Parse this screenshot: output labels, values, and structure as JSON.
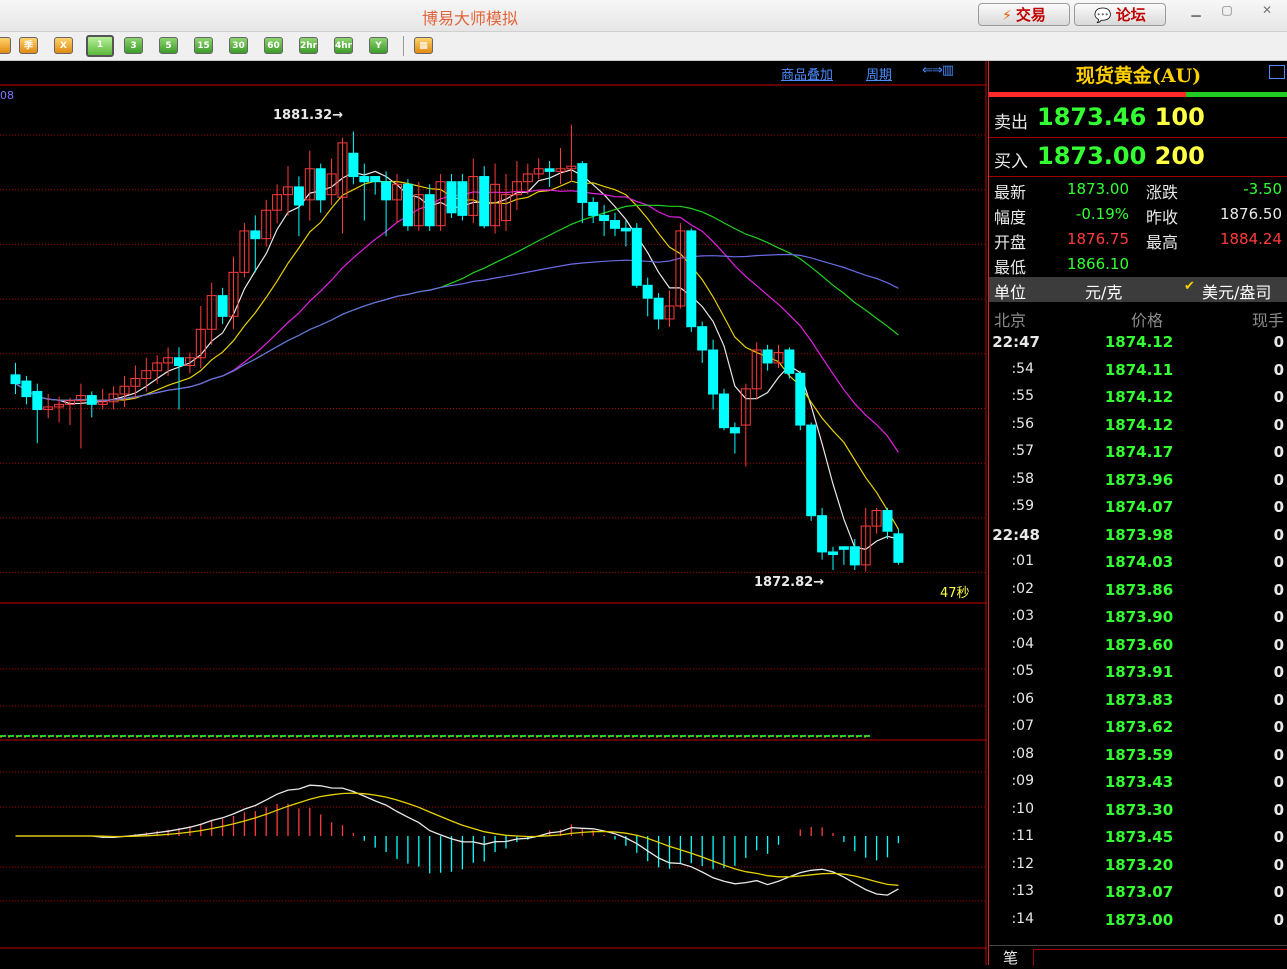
{
  "app": {
    "title": "博易大师模拟"
  },
  "titlebar": {
    "trade_label": "交易",
    "forum_label": "论坛"
  },
  "toolbar": {
    "buttons": [
      {
        "label": "季",
        "icon": "quarter-icon"
      },
      {
        "label": "X",
        "icon": "x-icon"
      },
      {
        "label": "1",
        "selected": true
      },
      {
        "label": "3"
      },
      {
        "label": "5"
      },
      {
        "label": "15"
      },
      {
        "label": "30"
      },
      {
        "label": "60"
      },
      {
        "label": "2hr"
      },
      {
        "label": "4hr"
      },
      {
        "label": "Y"
      }
    ]
  },
  "chart_links": {
    "overlay": "商品叠加",
    "period": "周期"
  },
  "chart_data": {
    "type": "candlestick",
    "high_label": "1881.32→",
    "low_label": "1872.82→",
    "countdown": "47秒",
    "indicator_label_fragment": "08",
    "candles": [
      [
        1876.62,
        1876.45,
        1876.85,
        1876.25
      ],
      [
        1876.5,
        1876.2,
        1876.6,
        1876.05
      ],
      [
        1876.3,
        1875.95,
        1876.45,
        1875.3
      ],
      [
        1875.95,
        1876.0,
        1876.25,
        1875.78
      ],
      [
        1876.0,
        1876.05,
        1876.2,
        1875.7
      ],
      [
        1876.05,
        1876.12,
        1876.18,
        1875.65
      ],
      [
        1876.12,
        1876.22,
        1876.45,
        1875.2
      ],
      [
        1876.22,
        1876.05,
        1876.3,
        1875.8
      ],
      [
        1876.05,
        1876.1,
        1876.35,
        1875.95
      ],
      [
        1876.1,
        1876.25,
        1876.4,
        1875.95
      ],
      [
        1876.25,
        1876.4,
        1876.6,
        1876.0
      ],
      [
        1876.4,
        1876.55,
        1876.8,
        1876.15
      ],
      [
        1876.55,
        1876.7,
        1876.95,
        1876.3
      ],
      [
        1876.7,
        1876.85,
        1877.0,
        1876.45
      ],
      [
        1876.85,
        1876.95,
        1877.15,
        1876.6
      ],
      [
        1876.95,
        1876.8,
        1877.15,
        1875.95
      ],
      [
        1876.8,
        1876.95,
        1877.05,
        1876.65
      ],
      [
        1876.95,
        1877.5,
        1877.95,
        1876.75
      ],
      [
        1877.5,
        1878.15,
        1878.4,
        1877.2
      ],
      [
        1878.15,
        1877.75,
        1878.3,
        1877.6
      ],
      [
        1877.75,
        1878.6,
        1878.9,
        1877.5
      ],
      [
        1878.6,
        1879.4,
        1879.55,
        1878.5
      ],
      [
        1879.4,
        1879.25,
        1879.7,
        1878.6
      ],
      [
        1879.25,
        1879.8,
        1880.0,
        1879.1
      ],
      [
        1879.8,
        1880.1,
        1880.3,
        1879.55
      ],
      [
        1880.1,
        1880.25,
        1880.65,
        1879.7
      ],
      [
        1880.25,
        1879.9,
        1880.45,
        1879.3
      ],
      [
        1880.0,
        1880.6,
        1880.95,
        1879.6
      ],
      [
        1880.6,
        1880.0,
        1880.7,
        1879.75
      ],
      [
        1880.1,
        1880.5,
        1880.8,
        1879.9
      ],
      [
        1880.05,
        1881.1,
        1881.2,
        1879.35
      ],
      [
        1880.9,
        1880.45,
        1881.32,
        1880.3
      ],
      [
        1880.45,
        1880.35,
        1880.7,
        1879.6
      ],
      [
        1880.45,
        1880.35,
        1880.45,
        1880.1
      ],
      [
        1880.35,
        1880.0,
        1880.55,
        1879.3
      ],
      [
        1880.0,
        1880.3,
        1880.5,
        1879.55
      ],
      [
        1880.3,
        1879.5,
        1880.4,
        1879.4
      ],
      [
        1879.5,
        1880.1,
        1880.35,
        1879.4
      ],
      [
        1880.1,
        1879.5,
        1880.3,
        1879.4
      ],
      [
        1879.5,
        1880.35,
        1880.5,
        1879.4
      ],
      [
        1880.35,
        1879.75,
        1880.5,
        1879.65
      ],
      [
        1880.35,
        1879.7,
        1880.5,
        1879.6
      ],
      [
        1879.7,
        1880.45,
        1880.8,
        1879.55
      ],
      [
        1880.45,
        1879.5,
        1880.65,
        1879.45
      ],
      [
        1879.5,
        1880.3,
        1880.7,
        1879.35
      ],
      [
        1879.6,
        1880.1,
        1880.5,
        1879.4
      ],
      [
        1880.1,
        1880.35,
        1880.75,
        1879.8
      ],
      [
        1880.35,
        1880.5,
        1880.7,
        1880.1
      ],
      [
        1880.5,
        1880.6,
        1880.8,
        1880.4
      ],
      [
        1880.6,
        1880.55,
        1880.75,
        1880.25
      ],
      [
        1880.55,
        1880.6,
        1881.0,
        1880.3
      ],
      [
        1880.6,
        1880.65,
        1881.45,
        1880.35
      ],
      [
        1880.7,
        1879.95,
        1880.75,
        1879.55
      ],
      [
        1879.95,
        1879.7,
        1880.05,
        1879.55
      ],
      [
        1879.7,
        1879.6,
        1879.9,
        1879.3
      ],
      [
        1879.6,
        1879.45,
        1879.75,
        1879.3
      ],
      [
        1879.45,
        1879.4,
        1879.6,
        1879.1
      ],
      [
        1879.45,
        1878.35,
        1879.55,
        1878.3
      ],
      [
        1878.35,
        1878.1,
        1878.5,
        1877.75
      ],
      [
        1878.1,
        1877.7,
        1878.2,
        1877.5
      ],
      [
        1877.7,
        1877.95,
        1878.25,
        1877.55
      ],
      [
        1877.95,
        1879.4,
        1879.55,
        1877.9
      ],
      [
        1879.4,
        1877.55,
        1879.45,
        1877.45
      ],
      [
        1877.55,
        1877.1,
        1877.65,
        1876.85
      ],
      [
        1877.1,
        1876.25,
        1877.3,
        1875.95
      ],
      [
        1876.25,
        1875.6,
        1876.35,
        1875.55
      ],
      [
        1875.6,
        1875.5,
        1875.7,
        1875.1
      ],
      [
        1875.65,
        1876.35,
        1876.45,
        1874.85
      ],
      [
        1876.35,
        1877.1,
        1877.25,
        1876.15
      ],
      [
        1877.1,
        1876.85,
        1877.2,
        1876.7
      ],
      [
        1876.85,
        1877.05,
        1877.2,
        1876.75
      ],
      [
        1877.1,
        1876.65,
        1877.15,
        1876.55
      ],
      [
        1876.65,
        1875.65,
        1876.7,
        1875.55
      ],
      [
        1875.65,
        1873.9,
        1875.7,
        1873.8
      ],
      [
        1873.9,
        1873.2,
        1874.05,
        1873.05
      ],
      [
        1873.2,
        1873.15,
        1873.3,
        1872.85
      ],
      [
        1873.3,
        1873.25,
        1873.3,
        1872.95
      ],
      [
        1873.3,
        1872.95,
        1873.45,
        1872.85
      ],
      [
        1872.95,
        1873.7,
        1874.05,
        1872.82
      ],
      [
        1873.7,
        1874.0,
        1874.05,
        1873.55
      ],
      [
        1874.0,
        1873.6,
        1874.05,
        1873.45
      ],
      [
        1873.55,
        1873.0,
        1873.65,
        1872.95
      ]
    ]
  },
  "quote": {
    "title": "现货黄金(AU)",
    "sell_label": "卖出",
    "sell_price": "1873.46",
    "sell_vol": "100",
    "buy_label": "买入",
    "buy_price": "1873.00",
    "buy_vol": "200",
    "stats": {
      "latest_label": "最新",
      "latest": "1873.00",
      "change_label": "涨跌",
      "change": "-3.50",
      "amp_label": "幅度",
      "amp": "-0.19%",
      "prev_label": "昨收",
      "prev": "1876.50",
      "open_label": "开盘",
      "open": "1876.75",
      "high_label": "最高",
      "high": "1884.24",
      "low_label": "最低",
      "low": "1866.10"
    },
    "unit_label": "单位",
    "unit_value": "元/克",
    "unit_option": "美元/盎司",
    "tick_head": {
      "time": "北京",
      "price": "价格",
      "volume": "现手"
    },
    "ticks": [
      {
        "time": "22:47",
        "price": "1874.12",
        "vol": "0"
      },
      {
        "time": ":54",
        "price": "1874.11",
        "vol": "0"
      },
      {
        "time": ":55",
        "price": "1874.12",
        "vol": "0"
      },
      {
        "time": ":56",
        "price": "1874.12",
        "vol": "0"
      },
      {
        "time": ":57",
        "price": "1874.17",
        "vol": "0"
      },
      {
        "time": ":58",
        "price": "1873.96",
        "vol": "0"
      },
      {
        "time": ":59",
        "price": "1874.07",
        "vol": "0"
      },
      {
        "time": "22:48",
        "price": "1873.98",
        "vol": "0"
      },
      {
        "time": ":01",
        "price": "1874.03",
        "vol": "0"
      },
      {
        "time": ":02",
        "price": "1873.86",
        "vol": "0"
      },
      {
        "time": ":03",
        "price": "1873.90",
        "vol": "0"
      },
      {
        "time": ":04",
        "price": "1873.60",
        "vol": "0"
      },
      {
        "time": ":05",
        "price": "1873.91",
        "vol": "0"
      },
      {
        "time": ":06",
        "price": "1873.83",
        "vol": "0"
      },
      {
        "time": ":07",
        "price": "1873.62",
        "vol": "0"
      },
      {
        "time": ":08",
        "price": "1873.59",
        "vol": "0"
      },
      {
        "time": ":09",
        "price": "1873.43",
        "vol": "0"
      },
      {
        "time": ":10",
        "price": "1873.30",
        "vol": "0"
      },
      {
        "time": ":11",
        "price": "1873.45",
        "vol": "0"
      },
      {
        "time": ":12",
        "price": "1873.20",
        "vol": "0"
      },
      {
        "time": ":13",
        "price": "1873.07",
        "vol": "0"
      },
      {
        "time": ":14",
        "price": "1873.00",
        "vol": "0"
      }
    ],
    "bottom_label": "笔"
  },
  "colors": {
    "up": "#ff3b3b",
    "down": "#00ffff",
    "grid": "#c00000",
    "price_up": "#ff3b3b",
    "price_down": "#33ff33"
  }
}
